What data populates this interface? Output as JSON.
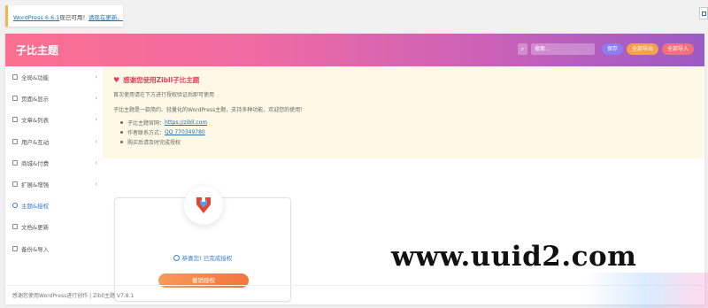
{
  "wp_notice": {
    "text": "WordPress 6.6.1",
    "text2": "现已可用！",
    "link": "请现在更新。"
  },
  "header": {
    "title": "子比主题",
    "search_placeholder": "搜索...",
    "save_label": "保存",
    "export_label": "全部导出",
    "import_label": "全部导入"
  },
  "sidebar": {
    "items": [
      {
        "label": "全局&功能",
        "icon": "globe-icon",
        "has_chevron": true
      },
      {
        "label": "页面&显示",
        "icon": "page-icon",
        "has_chevron": true
      },
      {
        "label": "文章&列表",
        "icon": "post-list-icon",
        "has_chevron": true
      },
      {
        "label": "用户&互动",
        "icon": "users-icon",
        "has_chevron": true
      },
      {
        "label": "商城&付费",
        "icon": "cart-icon",
        "has_chevron": true
      },
      {
        "label": "扩展&增强",
        "icon": "puzzle-icon",
        "has_chevron": true
      },
      {
        "label": "主题&授权",
        "icon": "shield-icon",
        "has_chevron": false,
        "active": true
      },
      {
        "label": "文档&更新",
        "icon": "refresh-icon",
        "has_chevron": false
      },
      {
        "label": "备份&导入",
        "icon": "backup-icon",
        "has_chevron": false
      }
    ]
  },
  "notice": {
    "title": "感谢您使用Zibll子比主题",
    "desc": "首次使用请在下方进行授权验证后即可使用",
    "intro": "子比主题是一款简约、轻量化的WordPress主题，支持多种功能，欢迎您的使用！",
    "items": [
      {
        "prefix": "子比主题官网：",
        "link": "https://zibll.com"
      },
      {
        "prefix": "作者联系方式：",
        "link": "QQ 770349780"
      },
      {
        "prefix": "购买后请及时完成授权",
        "link": ""
      }
    ]
  },
  "auth": {
    "status": "恭喜您! 已完成授权",
    "button": "撤销授权"
  },
  "footer": {
    "text": "感谢您使用WordPress进行创作 | Zibll主题 V7.8.1"
  },
  "watermark": "www.uuid2.com",
  "colors": {
    "header_start": "#fb6f8f",
    "header_end": "#9a5bc4",
    "accent": "#3a7bd5",
    "notice_bg": "#fef8e6",
    "heart": "#e0405a"
  }
}
